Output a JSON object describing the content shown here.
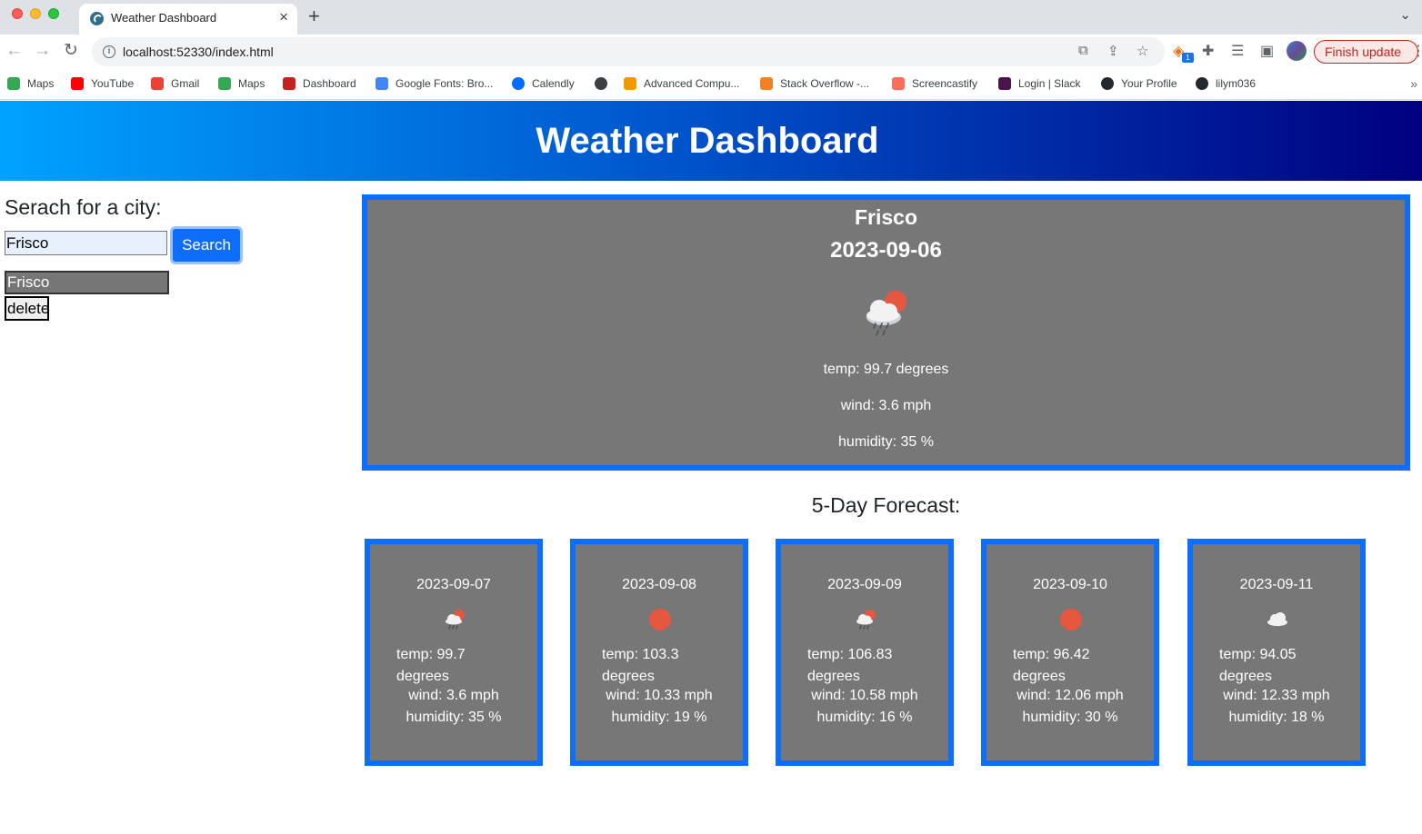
{
  "browser": {
    "tab_title": "Weather Dashboard",
    "tab_close": "×",
    "new_tab": "+",
    "url": "localhost:52330/index.html",
    "finish_update": "Finish update",
    "extension_badge": "1",
    "bookmarks": [
      {
        "label": "Maps",
        "icon": "maps-pin-icon",
        "color": "#34a853"
      },
      {
        "label": "YouTube",
        "icon": "youtube-icon",
        "color": "#ff0000"
      },
      {
        "label": "Gmail",
        "icon": "gmail-icon",
        "color": "#ea4335"
      },
      {
        "label": "Maps",
        "icon": "maps-pin-icon",
        "color": "#34a853"
      },
      {
        "label": "Dashboard",
        "icon": "dashboard-icon",
        "color": "#c5221f"
      },
      {
        "label": "Google Fonts: Bro...",
        "icon": "google-fonts-icon",
        "color": "#4285f4"
      },
      {
        "label": "Calendly",
        "icon": "calendly-icon",
        "color": "#006bff"
      },
      {
        "label": "",
        "icon": "globe-icon",
        "color": "#3c4043"
      },
      {
        "label": "Advanced Compu...",
        "icon": "fs-icon",
        "color": "#f29900"
      },
      {
        "label": "Stack Overflow -...",
        "icon": "stackoverflow-icon",
        "color": "#f48024"
      },
      {
        "label": "Screencastify",
        "icon": "screencastify-icon",
        "color": "#ff6d5a"
      },
      {
        "label": "Login | Slack",
        "icon": "slack-icon",
        "color": "#4a154b"
      },
      {
        "label": "Your Profile",
        "icon": "github-icon",
        "color": "#24292f"
      },
      {
        "label": "lilym036",
        "icon": "github-icon",
        "color": "#24292f"
      }
    ]
  },
  "header": {
    "title": "Weather Dashboard"
  },
  "search": {
    "heading": "Serach for a city:",
    "input_value": "Frisco",
    "button_label": "Search"
  },
  "history": {
    "items": [
      "Frisco"
    ],
    "delete_label": "delete"
  },
  "current": {
    "city": "Frisco",
    "date": "2023-09-06",
    "icon": "rain-sun-icon",
    "temp": "temp: 99.7 degrees",
    "wind": "wind: 3.6 mph",
    "humidity": "humidity: 35 %"
  },
  "forecast": {
    "heading": "5-Day Forecast:",
    "days": [
      {
        "date": "2023-09-07",
        "icon": "rain-sun-icon",
        "temp": "temp: 99.7 degrees",
        "wind": "wind: 3.6 mph",
        "humidity": "humidity: 35 %"
      },
      {
        "date": "2023-09-08",
        "icon": "sun-icon",
        "temp": "temp: 103.3 degrees",
        "wind": "wind: 10.33 mph",
        "humidity": "humidity: 19 %"
      },
      {
        "date": "2023-09-09",
        "icon": "rain-sun-icon",
        "temp": "temp: 106.83 degrees",
        "wind": "wind: 10.58 mph",
        "humidity": "humidity: 16 %"
      },
      {
        "date": "2023-09-10",
        "icon": "sun-icon",
        "temp": "temp: 96.42 degrees",
        "wind": "wind: 12.06 mph",
        "humidity": "humidity: 30 %"
      },
      {
        "date": "2023-09-11",
        "icon": "cloud-icon",
        "temp": "temp: 94.05 degrees",
        "wind": "wind: 12.33 mph",
        "humidity": "humidity: 18 %"
      }
    ]
  },
  "colors": {
    "header_gradient": [
      "#00a2ff",
      "#0050c8",
      "#000080"
    ],
    "card_bg": "#777777",
    "card_border": "#0d6efd",
    "search_button": "#0d6efd",
    "sun": "#e6573f"
  }
}
